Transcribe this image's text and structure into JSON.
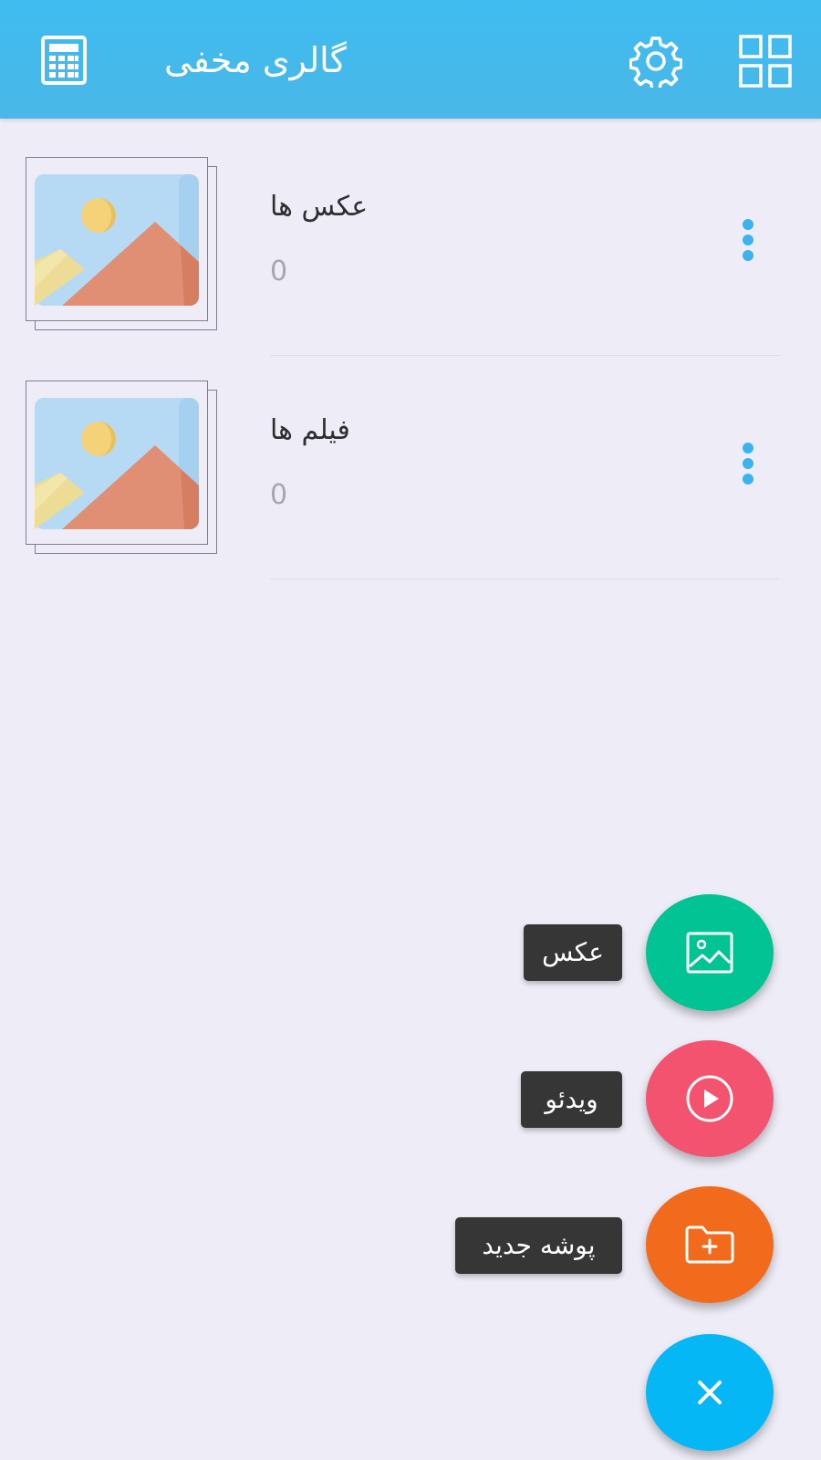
{
  "header": {
    "title": "گالری مخفی",
    "icons": {
      "calculator": "calculator-icon",
      "settings": "gear-icon",
      "view": "grid-view-icon"
    },
    "color": "#3fbcf0"
  },
  "albums": [
    {
      "name": "عکس ها",
      "count": "0"
    },
    {
      "name": "فیلم ها",
      "count": "0"
    }
  ],
  "fab_menu": {
    "photo": {
      "label": "عکس",
      "icon": "image-icon",
      "color": "#02c393"
    },
    "video": {
      "label": "ویدئو",
      "icon": "play-icon",
      "color": "#f4536f"
    },
    "folder": {
      "label": "پوشه جدید",
      "icon": "folder-plus-icon",
      "color": "#f26a1b"
    },
    "close": {
      "icon": "close-icon",
      "color": "#05b7f5"
    }
  }
}
